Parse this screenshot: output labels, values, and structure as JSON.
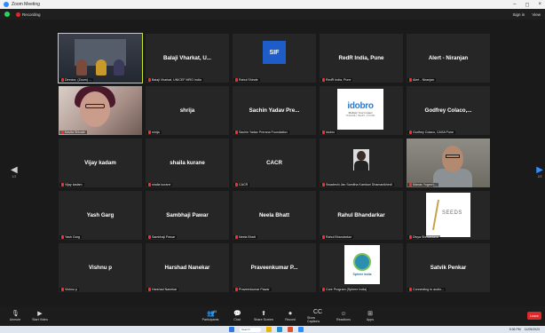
{
  "window": {
    "title": "Zoom Meeting"
  },
  "topbar": {
    "recording_label": "Recording",
    "right_items": [
      "Sign in",
      "View"
    ]
  },
  "tiles": [
    {
      "display": "video",
      "kind": "room",
      "label": "Director, (Zoom) ...",
      "active": true
    },
    {
      "display": "name",
      "name": "Balaji Vharkat, U...",
      "label": "Balaji Vharkat, UNICEF MRO India"
    },
    {
      "display": "logo",
      "kind": "sif",
      "logo_text": "SIF",
      "label": "Rahul Shinde"
    },
    {
      "display": "name",
      "name": "RedR India, Pune",
      "label": "RedR India, Pune"
    },
    {
      "display": "name",
      "name": "Alert - Niranjan",
      "label": "Alert - Niranjan"
    },
    {
      "display": "video",
      "kind": "face",
      "label": "Kavita Shivale"
    },
    {
      "display": "name",
      "name": "shrija",
      "label": "shrija"
    },
    {
      "display": "name",
      "name": "Sachin Yadav Pre...",
      "label": "Sachin Yadav Prerana Foundation"
    },
    {
      "display": "logo",
      "kind": "idobro",
      "logo_word": "idobro",
      "logo_tag": "Multiply Your Impact",
      "logo_tag2": "HUMANE • HEART • FOUND",
      "label": "idobro"
    },
    {
      "display": "name",
      "name": "Godfrey Colaco,...",
      "label": "Godfrey Colaco, CASA Pune"
    },
    {
      "display": "name",
      "name": "Vijay kadam",
      "label": "Vijay kadam"
    },
    {
      "display": "name",
      "name": "shaila kurane",
      "label": "shaila kurane"
    },
    {
      "display": "name",
      "name": "CACR",
      "label": "CACR"
    },
    {
      "display": "logo",
      "kind": "man-small",
      "label": "Swadeshi Jan Samitha Kamkari Dhamanikhedi"
    },
    {
      "display": "video",
      "kind": "man-photo",
      "label": "Manas Yogesh..."
    },
    {
      "display": "name",
      "name": "Yash Garg",
      "label": "Yash Garg"
    },
    {
      "display": "name",
      "name": "Sambhaji Pawar",
      "label": "Sambhaji Pawar"
    },
    {
      "display": "name",
      "name": "Neela Bhatt",
      "label": "Neela Bhatt"
    },
    {
      "display": "name",
      "name": "Rahul Bhandarkar",
      "label": "Rahul Bhandarkar"
    },
    {
      "display": "logo",
      "kind": "seeds",
      "logo_text": "SEEDS",
      "label": "Divya Shrivastava"
    },
    {
      "display": "name",
      "name": "Vishnu p",
      "label": "Vishnu p"
    },
    {
      "display": "name",
      "name": "Harshad Nanekar",
      "label": "Harshad Nanekar"
    },
    {
      "display": "name",
      "name": "Praveenkumar P...",
      "label": "Praveenkumar Pawar"
    },
    {
      "display": "logo",
      "kind": "sphere",
      "logo_text": "Sphere India",
      "label": "Core Program (Sphere India)"
    },
    {
      "display": "name",
      "name": "Satvik Penkar",
      "label": "Connecting to audio..."
    }
  ],
  "nav": {
    "left_page": "1/2",
    "right_page": "2/2"
  },
  "toolbar": {
    "left": [
      {
        "icon": "mic-icon",
        "glyph": "🎙",
        "label": "Unmute"
      },
      {
        "icon": "video-icon",
        "glyph": "▶",
        "label": "Start Video"
      }
    ],
    "center": [
      {
        "icon": "participants-icon",
        "glyph": "👥",
        "label": "Participants",
        "badge": "44"
      },
      {
        "icon": "chat-icon",
        "glyph": "💬",
        "label": "Chat"
      },
      {
        "icon": "share-screen-icon",
        "glyph": "⬆",
        "label": "Share Screen"
      },
      {
        "icon": "record-icon",
        "glyph": "⏺",
        "label": "Record"
      },
      {
        "icon": "captions-icon",
        "glyph": "CC",
        "label": "Show Captions"
      },
      {
        "icon": "reactions-icon",
        "glyph": "☺",
        "label": "Reactions"
      },
      {
        "icon": "apps-icon",
        "glyph": "⊞",
        "label": "Apps"
      }
    ],
    "leave_label": "Leave"
  },
  "taskbar": {
    "search_placeholder": "Search",
    "time": "5:36 PM",
    "date": "11/09/2023"
  }
}
